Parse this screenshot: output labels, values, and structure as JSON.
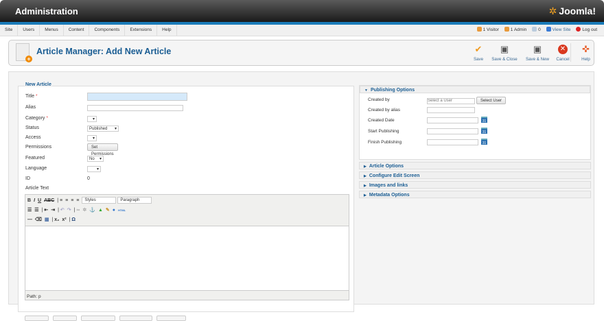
{
  "header": {
    "title": "Administration",
    "logo": "Joomla!"
  },
  "menu": [
    "Site",
    "Users",
    "Menus",
    "Content",
    "Components",
    "Extensions",
    "Help"
  ],
  "status": {
    "visitors": "1 Visitor",
    "admins": "1 Admin",
    "messages": "0",
    "view_site": "View Site",
    "logout": "Log out"
  },
  "toolbar": {
    "title": "Article Manager: Add New Article",
    "save": "Save",
    "save_close": "Save & Close",
    "save_new": "Save & New",
    "cancel": "Cancel",
    "help": "Help"
  },
  "form": {
    "legend": "New Article",
    "title_label": "Title",
    "alias_label": "Alias",
    "category_label": "Category",
    "status_label": "Status",
    "status_value": "Published",
    "access_label": "Access",
    "permissions_label": "Permissions",
    "permissions_button": "Set Permissions",
    "featured_label": "Featured",
    "featured_value": "No",
    "language_label": "Language",
    "id_label": "ID",
    "id_value": "0",
    "article_text_label": "Article Text",
    "required": "*"
  },
  "editor": {
    "styles": "Styles",
    "format": "Paragraph",
    "path": "Path: p"
  },
  "publishing": {
    "header": "Publishing Options",
    "created_by": "Created by",
    "created_by_placeholder": "Select a User",
    "select_user": "Select User",
    "created_by_alias": "Created by alias",
    "created_date": "Created Date",
    "start_publishing": "Start Publishing",
    "finish_publishing": "Finish Publishing",
    "calendar_day": "31"
  },
  "accordions": [
    "Article Options",
    "Configure Edit Screen",
    "Images and links",
    "Metadata Options"
  ]
}
